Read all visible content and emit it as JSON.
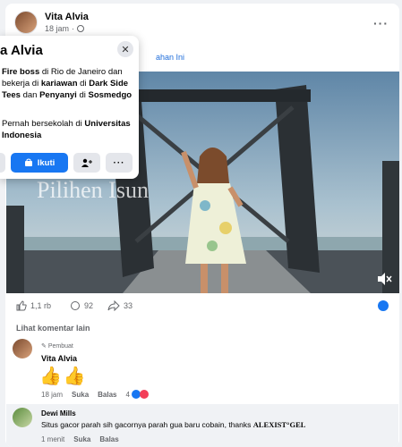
{
  "post": {
    "author": "Vita Alvia",
    "time": "18 jam",
    "caption_link": "ahan Ini"
  },
  "video": {
    "overlay_text": "Pilihen Isun"
  },
  "actions": {
    "likes": "1,1 rb",
    "comments": "92",
    "shares": "33"
  },
  "comments": {
    "more_label": "Lihat komentar lain",
    "c1": {
      "badge": "Pembuat",
      "name": "Vita Alvia",
      "body": "👍👍",
      "time": "18 jam",
      "like": "Suka",
      "reply": "Balas",
      "reaction_count": "4"
    },
    "c2": {
      "name": "Dewi Mills",
      "text": "Situs gacor parah sih gacornya parah gua baru cobain, thanks ",
      "brand": "ALEXIST°GEL",
      "time": "1 menit",
      "like": "Suka",
      "reply": "Balas"
    }
  },
  "popup": {
    "title": "a Alvia",
    "info1_bold1": "Fire boss",
    "info1_t1": " di Rio de Janeiro dan bekerja di ",
    "info1_bold2": "kariawan",
    "info1_t2": " di ",
    "info1_bold3": "Dark Side Tees",
    "info1_t3": " dan ",
    "info1_bold4": "Penyanyi",
    "info1_t4": " di ",
    "info1_bold5": "Sosmedgo",
    "info2_t1": "Pernah bersekolah di ",
    "info2_bold": "Universitas Indonesia",
    "follow_label": "Ikuti"
  }
}
